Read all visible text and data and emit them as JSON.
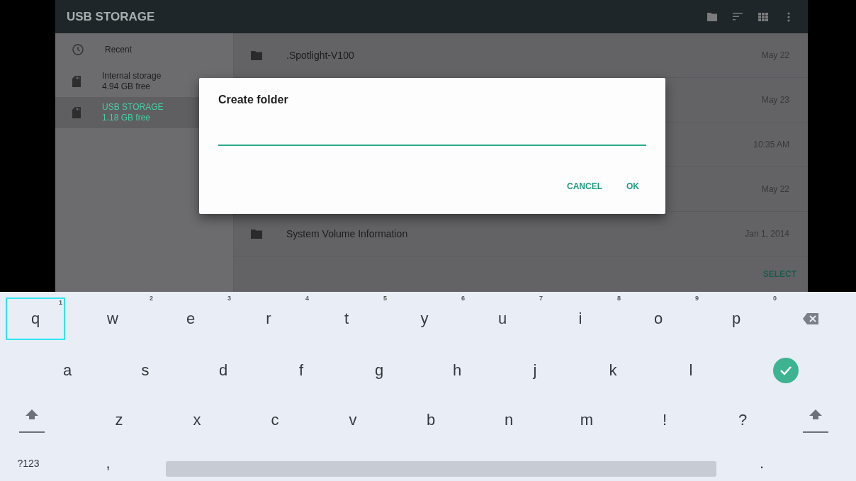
{
  "app_bar": {
    "title": "USB STORAGE",
    "actions": [
      {
        "kind": "folder"
      },
      {
        "kind": "sort"
      },
      {
        "kind": "grid"
      },
      {
        "kind": "more"
      }
    ]
  },
  "sidebar": {
    "items": [
      {
        "kind": "recent",
        "label": "Recent",
        "selected": false
      },
      {
        "kind": "storage",
        "label": "Internal storage",
        "detail": "4.94 GB free",
        "selected": false
      },
      {
        "kind": "storage",
        "label": "USB STORAGE",
        "detail": "1.18 GB free",
        "selected": true
      }
    ]
  },
  "files": [
    {
      "name": ".Spotlight-V100",
      "date": "May 22"
    },
    {
      "date": "May 23"
    },
    {
      "date": "10:35 AM"
    },
    {
      "date": "May 22"
    },
    {
      "name": "System Volume Information",
      "date": "Jan 1, 2014"
    }
  ],
  "select_button": "SELECT",
  "dialog": {
    "title": "Create folder",
    "buttons": [
      "CANCEL",
      "OK"
    ]
  },
  "keyboard": {
    "rows": [
      [
        {
          "kind": "char",
          "label": "q",
          "hint": "1",
          "focused": true
        },
        {
          "kind": "char",
          "label": "w",
          "hint": "2",
          "focused": false
        },
        {
          "kind": "char",
          "label": "e",
          "hint": "3",
          "focused": false
        },
        {
          "kind": "char",
          "label": "r",
          "hint": "4",
          "focused": false
        },
        {
          "kind": "char",
          "label": "t",
          "hint": "5",
          "focused": false
        },
        {
          "kind": "char",
          "label": "y",
          "hint": "6",
          "focused": false
        },
        {
          "kind": "char",
          "label": "u",
          "hint": "7",
          "focused": false
        },
        {
          "kind": "char",
          "label": "i",
          "hint": "8",
          "focused": false
        },
        {
          "kind": "char",
          "label": "o",
          "hint": "9",
          "focused": false
        },
        {
          "kind": "char",
          "label": "p",
          "hint": "0",
          "focused": false
        },
        {
          "kind": "backspace",
          "focused": false
        }
      ],
      [
        {
          "kind": "char",
          "label": "a",
          "focused": false
        },
        {
          "kind": "char",
          "label": "s",
          "focused": false
        },
        {
          "kind": "char",
          "label": "d",
          "focused": false
        },
        {
          "kind": "char",
          "label": "f",
          "focused": false
        },
        {
          "kind": "char",
          "label": "g",
          "focused": false
        },
        {
          "kind": "char",
          "label": "h",
          "focused": false
        },
        {
          "kind": "char",
          "label": "j",
          "focused": false
        },
        {
          "kind": "char",
          "label": "k",
          "focused": false
        },
        {
          "kind": "char",
          "label": "l",
          "focused": false
        },
        {
          "kind": "enter",
          "focused": false
        }
      ],
      [
        {
          "kind": "shift",
          "focused": false
        },
        {
          "kind": "char",
          "label": "z",
          "focused": false
        },
        {
          "kind": "char",
          "label": "x",
          "focused": false
        },
        {
          "kind": "char",
          "label": "c",
          "focused": false
        },
        {
          "kind": "char",
          "label": "v",
          "focused": false
        },
        {
          "kind": "char",
          "label": "b",
          "focused": false
        },
        {
          "kind": "char",
          "label": "n",
          "focused": false
        },
        {
          "kind": "char",
          "label": "m",
          "focused": false
        },
        {
          "kind": "char",
          "label": "!",
          "focused": false
        },
        {
          "kind": "char",
          "label": "?",
          "focused": false
        },
        {
          "kind": "shift",
          "focused": false
        }
      ],
      [
        {
          "kind": "mode",
          "label": "?123",
          "focused": false
        },
        {
          "kind": "char",
          "label": ",",
          "focused": false
        },
        {
          "kind": "space",
          "focused": false
        },
        {
          "kind": "char",
          "label": ".",
          "focused": false
        }
      ]
    ]
  }
}
